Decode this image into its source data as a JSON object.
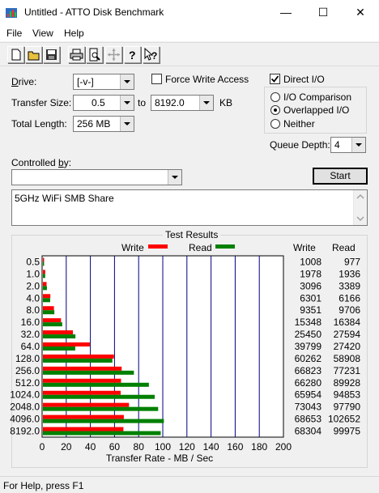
{
  "window": {
    "title": "Untitled - ATTO Disk Benchmark",
    "minimize": "—",
    "maximize": "☐",
    "close": "✕"
  },
  "menu": [
    "File",
    "View",
    "Help"
  ],
  "toolbar": [
    "new-icon",
    "open-icon",
    "save-icon",
    "print-icon",
    "print-preview-icon",
    "move-icon",
    "help-icon",
    "context-help-icon"
  ],
  "settings": {
    "drive_label": "Drive:",
    "drive_value": "[-v-]",
    "transfer_size_label": "Transfer Size:",
    "transfer_from": "0.5",
    "to_label": "to",
    "transfer_to": "8192.0",
    "unit": "KB",
    "total_length_label": "Total Length:",
    "total_length": "256 MB",
    "force_write_label": "Force Write Access",
    "force_write_checked": false,
    "direct_io_label": "Direct I/O",
    "direct_io_checked": true,
    "io_comparison_label": "I/O Comparison",
    "overlapped_io_label": "Overlapped I/O",
    "neither_label": "Neither",
    "selected_mode": "Overlapped I/O",
    "queue_depth_label": "Queue Depth:",
    "queue_depth": "4",
    "controlled_by_label": "Controlled by:",
    "controlled_by": "",
    "start_label": "Start",
    "description": "5GHz WiFi SMB Share"
  },
  "results": {
    "group_title": "Test Results",
    "write_col": "Write",
    "read_col": "Read",
    "write_color": "#ff0000",
    "read_color": "#008000"
  },
  "chart_data": {
    "type": "bar",
    "orientation": "horizontal",
    "categories": [
      "0.5",
      "1.0",
      "2.0",
      "4.0",
      "8.0",
      "16.0",
      "32.0",
      "64.0",
      "128.0",
      "256.0",
      "512.0",
      "1024.0",
      "2048.0",
      "4096.0",
      "8192.0"
    ],
    "series": [
      {
        "name": "Write",
        "values": [
          1008,
          1978,
          3096,
          6301,
          9351,
          15348,
          25450,
          39799,
          60262,
          66823,
          66280,
          65954,
          73043,
          68653,
          68304
        ]
      },
      {
        "name": "Read",
        "values": [
          977,
          1936,
          3389,
          6166,
          9706,
          16384,
          27594,
          27420,
          58908,
          77231,
          89928,
          94853,
          97790,
          102652,
          99975
        ]
      }
    ],
    "xlabel": "Transfer Rate - MB / Sec",
    "xlim": [
      0,
      200
    ],
    "xticks": [
      "0",
      "20",
      "40",
      "60",
      "80",
      "100",
      "120",
      "140",
      "160",
      "180",
      "200"
    ],
    "grid": true,
    "legend": "top"
  },
  "status": {
    "text": "For Help, press F1"
  }
}
